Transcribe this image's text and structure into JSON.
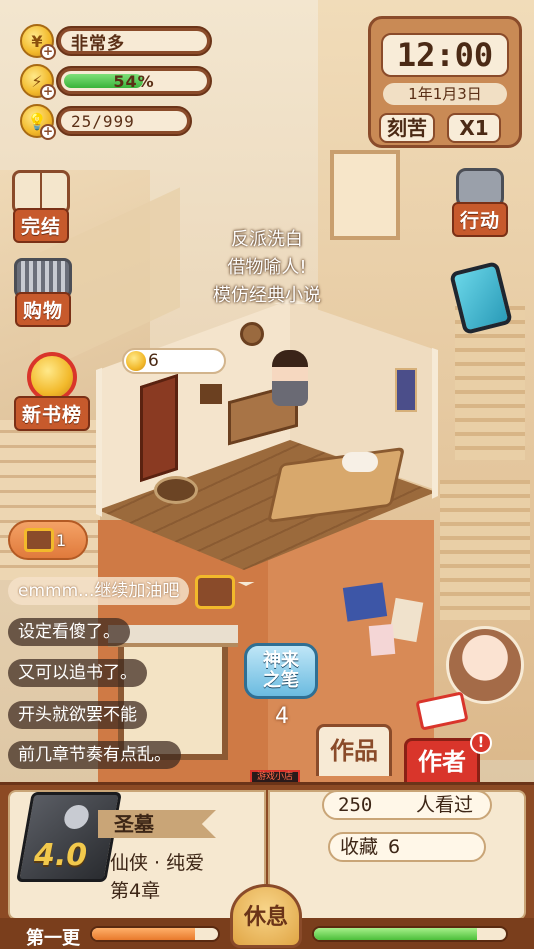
{
  "hud": {
    "title_label": "非常多",
    "energy_percent_label": "54%",
    "energy_level": 0.54,
    "idea_count": "25/999",
    "plus_sign": "+"
  },
  "clock": {
    "time": "12:00",
    "date": "1年1月3日",
    "effort_button": "刻苦",
    "speed_button": "X1"
  },
  "left_menu": {
    "finish": "完结",
    "shop": "购物",
    "new_books": "新书榜"
  },
  "right_menu": {
    "action": "行动"
  },
  "scene": {
    "novel_tags": [
      "反派洗白",
      "借物喻人!",
      "模仿经典小说"
    ],
    "coin_bubble_value": "6",
    "treasure_count": "1",
    "skill_button": "神来之笔",
    "skill_count": "4",
    "sign_text": "游戏小店"
  },
  "comments": [
    "emmm...继续加油吧",
    "设定看傻了。",
    "又可以追书了。",
    "开头就欲罢不能",
    "前几章节奏有点乱。"
  ],
  "tabs": {
    "works": "作品",
    "author": "作者",
    "alert": "!"
  },
  "book": {
    "rating": "4.0",
    "title": "圣墓",
    "genre": "仙侠 · 纯爱",
    "chapter": "第4章",
    "readers_count": "250",
    "readers_label": "人看过",
    "favorites_label": "收藏",
    "favorites_count": "6"
  },
  "footer": {
    "update_label": "第一更",
    "rest_button": "休息",
    "left_progress": 0.82,
    "right_progress": 0.85
  },
  "colors": {
    "brand_brown": "#8a4b2a",
    "energy_green": "#3ab33a",
    "accent_red": "#d9352b",
    "wall_orange": "#d9804a"
  }
}
